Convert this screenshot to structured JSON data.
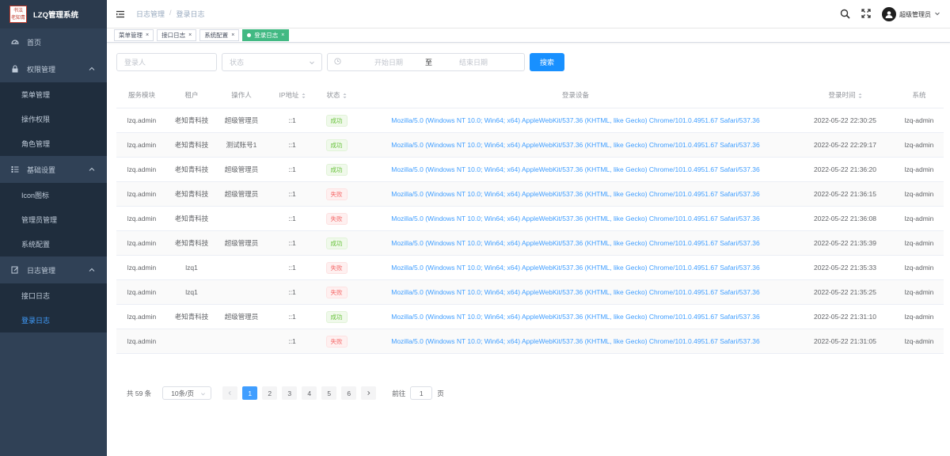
{
  "app": {
    "title": "LZQ管理系统",
    "logo_text": [
      "书法",
      "老知青"
    ]
  },
  "sidebar": {
    "home": "首页",
    "groups": [
      {
        "label": "权限管理",
        "items": [
          "菜单管理",
          "操作权限",
          "角色管理"
        ]
      },
      {
        "label": "基础设置",
        "items": [
          "Icon图标",
          "管理员管理",
          "系统配置"
        ]
      },
      {
        "label": "日志管理",
        "items": [
          "接口日志",
          "登录日志"
        ]
      }
    ],
    "active_item": "登录日志"
  },
  "header": {
    "breadcrumb": [
      "日志管理",
      "登录日志"
    ],
    "breadcrumb_sep": "/",
    "user_name": "超级管理员"
  },
  "tags": [
    {
      "label": "菜单管理",
      "active": false
    },
    {
      "label": "接口日志",
      "active": false
    },
    {
      "label": "系统配置",
      "active": false
    },
    {
      "label": "登录日志",
      "active": true
    }
  ],
  "filter": {
    "user_placeholder": "登录人",
    "status_placeholder": "状态",
    "start_placeholder": "开始日期",
    "range_sep": "至",
    "end_placeholder": "结束日期",
    "search_label": "搜索"
  },
  "table": {
    "columns": [
      "服务模块",
      "租户",
      "操作人",
      "IP地址",
      "状态",
      "登录设备",
      "登录时间",
      "系统"
    ],
    "rows": [
      {
        "module": "lzq.admin",
        "tenant": "老知青科技",
        "operator": "超级管理员",
        "ip": "::1",
        "status": "成功",
        "ok": true,
        "device": "Mozilla/5.0 (Windows NT 10.0; Win64; x64) AppleWebKit/537.36 (KHTML, like Gecko) Chrome/101.0.4951.67 Safari/537.36",
        "time": "2022-05-22 22:30:25",
        "system": "lzq-admin"
      },
      {
        "module": "lzq.admin",
        "tenant": "老知青科技",
        "operator": "测试账号1",
        "ip": "::1",
        "status": "成功",
        "ok": true,
        "device": "Mozilla/5.0 (Windows NT 10.0; Win64; x64) AppleWebKit/537.36 (KHTML, like Gecko) Chrome/101.0.4951.67 Safari/537.36",
        "time": "2022-05-22 22:29:17",
        "system": "lzq-admin"
      },
      {
        "module": "lzq.admin",
        "tenant": "老知青科技",
        "operator": "超级管理员",
        "ip": "::1",
        "status": "成功",
        "ok": true,
        "device": "Mozilla/5.0 (Windows NT 10.0; Win64; x64) AppleWebKit/537.36 (KHTML, like Gecko) Chrome/101.0.4951.67 Safari/537.36",
        "time": "2022-05-22 21:36:20",
        "system": "lzq-admin"
      },
      {
        "module": "lzq.admin",
        "tenant": "老知青科技",
        "operator": "超级管理员",
        "ip": "::1",
        "status": "失败",
        "ok": false,
        "device": "Mozilla/5.0 (Windows NT 10.0; Win64; x64) AppleWebKit/537.36 (KHTML, like Gecko) Chrome/101.0.4951.67 Safari/537.36",
        "time": "2022-05-22 21:36:15",
        "system": "lzq-admin"
      },
      {
        "module": "lzq.admin",
        "tenant": "老知青科技",
        "operator": "",
        "ip": "::1",
        "status": "失败",
        "ok": false,
        "device": "Mozilla/5.0 (Windows NT 10.0; Win64; x64) AppleWebKit/537.36 (KHTML, like Gecko) Chrome/101.0.4951.67 Safari/537.36",
        "time": "2022-05-22 21:36:08",
        "system": "lzq-admin"
      },
      {
        "module": "lzq.admin",
        "tenant": "老知青科技",
        "operator": "超级管理员",
        "ip": "::1",
        "status": "成功",
        "ok": true,
        "device": "Mozilla/5.0 (Windows NT 10.0; Win64; x64) AppleWebKit/537.36 (KHTML, like Gecko) Chrome/101.0.4951.67 Safari/537.36",
        "time": "2022-05-22 21:35:39",
        "system": "lzq-admin"
      },
      {
        "module": "lzq.admin",
        "tenant": "lzq1",
        "operator": "",
        "ip": "::1",
        "status": "失败",
        "ok": false,
        "device": "Mozilla/5.0 (Windows NT 10.0; Win64; x64) AppleWebKit/537.36 (KHTML, like Gecko) Chrome/101.0.4951.67 Safari/537.36",
        "time": "2022-05-22 21:35:33",
        "system": "lzq-admin"
      },
      {
        "module": "lzq.admin",
        "tenant": "lzq1",
        "operator": "",
        "ip": "::1",
        "status": "失败",
        "ok": false,
        "device": "Mozilla/5.0 (Windows NT 10.0; Win64; x64) AppleWebKit/537.36 (KHTML, like Gecko) Chrome/101.0.4951.67 Safari/537.36",
        "time": "2022-05-22 21:35:25",
        "system": "lzq-admin"
      },
      {
        "module": "lzq.admin",
        "tenant": "老知青科技",
        "operator": "超级管理员",
        "ip": "::1",
        "status": "成功",
        "ok": true,
        "device": "Mozilla/5.0 (Windows NT 10.0; Win64; x64) AppleWebKit/537.36 (KHTML, like Gecko) Chrome/101.0.4951.67 Safari/537.36",
        "time": "2022-05-22 21:31:10",
        "system": "lzq-admin"
      },
      {
        "module": "lzq.admin",
        "tenant": "",
        "operator": "",
        "ip": "::1",
        "status": "失败",
        "ok": false,
        "device": "Mozilla/5.0 (Windows NT 10.0; Win64; x64) AppleWebKit/537.36 (KHTML, like Gecko) Chrome/101.0.4951.67 Safari/537.36",
        "time": "2022-05-22 21:31:05",
        "system": "lzq-admin"
      }
    ]
  },
  "pagination": {
    "total_label": "共 59 条",
    "page_size": "10条/页",
    "pages": [
      "1",
      "2",
      "3",
      "4",
      "5",
      "6"
    ],
    "current": "1",
    "goto_prefix": "前往",
    "goto_value": "1",
    "goto_suffix": "页"
  },
  "colors": {
    "sidebar_bg": "#304156",
    "submenu_bg": "#1f2d3d",
    "primary": "#1890ff",
    "tag_active": "#42b983",
    "success": "#67c23a",
    "danger": "#f56c6c"
  }
}
